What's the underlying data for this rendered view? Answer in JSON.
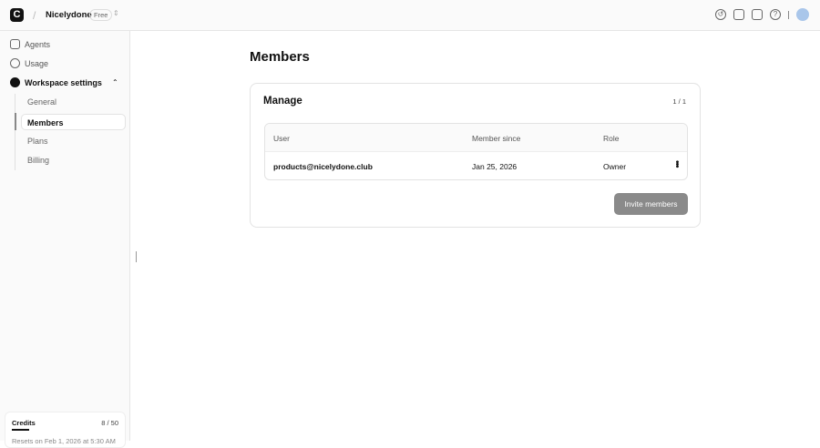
{
  "header": {
    "logo": "C",
    "workspace": "Nicelydone",
    "plan_badge": "Free",
    "icons": [
      "history-icon",
      "gift-icon",
      "file-icon",
      "help-icon"
    ]
  },
  "sidebar": {
    "items": [
      {
        "label": "Agents"
      },
      {
        "label": "Usage"
      },
      {
        "label": "Workspace settings"
      }
    ],
    "sub_items": [
      {
        "label": "General"
      },
      {
        "label": "Members"
      },
      {
        "label": "Plans"
      },
      {
        "label": "Billing"
      }
    ],
    "credits": {
      "label": "Credits",
      "value": "8 / 50",
      "reset": "Resets on Feb 1, 2026 at 5:30 AM"
    }
  },
  "main": {
    "title": "Members",
    "card_title": "Manage",
    "pagination": "1 / 1",
    "columns": [
      "User",
      "Member since",
      "Role"
    ],
    "rows": [
      {
        "user": "products@nicelydone.club",
        "since": "Jan 25, 2026",
        "role": "Owner"
      }
    ],
    "invite_label": "Invite members"
  }
}
